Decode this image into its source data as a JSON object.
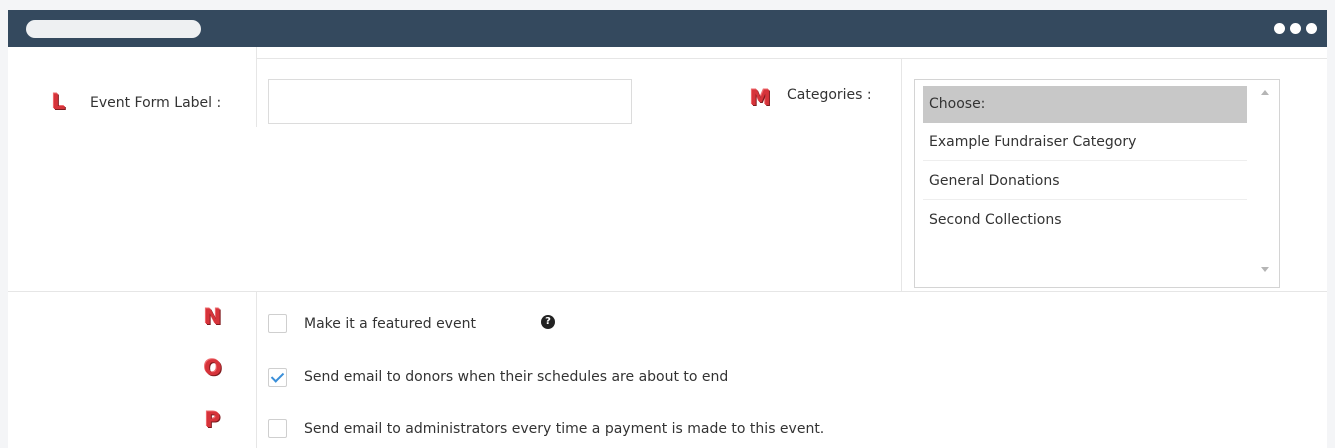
{
  "form": {
    "event_form_label": {
      "marker": "L",
      "label": "Event Form Label :",
      "value": ""
    },
    "categories": {
      "marker": "M",
      "label": "Categories :",
      "options": [
        {
          "label": "Choose:",
          "selected": true
        },
        {
          "label": "Example Fundraiser Category",
          "selected": false
        },
        {
          "label": "General Donations",
          "selected": false
        },
        {
          "label": "Second Collections",
          "selected": false
        }
      ]
    },
    "featured": {
      "marker": "N",
      "label": "Make it a featured event",
      "checked": false,
      "help_icon": "?"
    },
    "email_donors": {
      "marker": "O",
      "label": "Send email to donors when their schedules are about to end",
      "checked": true
    },
    "email_admins": {
      "marker": "P",
      "label": "Send email to administrators every time a payment is made to this event.",
      "checked": false
    }
  },
  "colors": {
    "titlebar": "#34495e",
    "marker": "#d6333a",
    "checkmark": "#3a8fd9",
    "selected_option": "#c8c8c8"
  }
}
